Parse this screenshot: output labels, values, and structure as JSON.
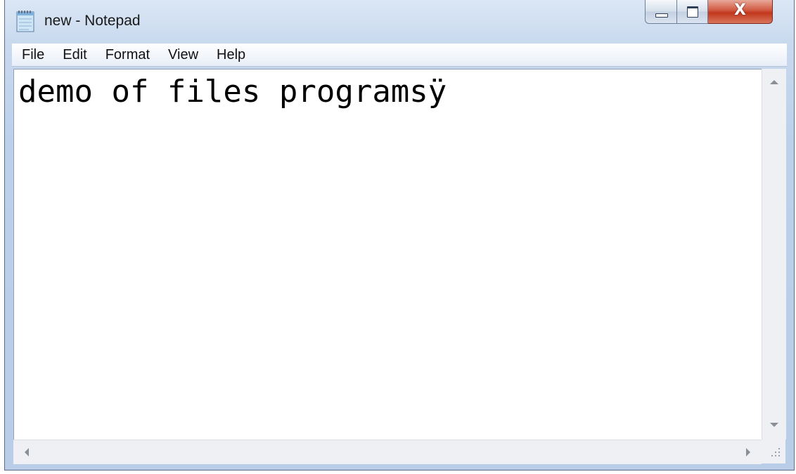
{
  "window": {
    "title": "new - Notepad",
    "close_glyph": "X"
  },
  "icons": {
    "app": "notepad-icon",
    "minimize": "minimize-icon",
    "maximize": "maximize-icon",
    "close": "close-icon"
  },
  "menubar": {
    "items": [
      "File",
      "Edit",
      "Format",
      "View",
      "Help"
    ]
  },
  "editor": {
    "content": "demo of files programsÿ"
  },
  "colors": {
    "close_button": "#c2361c",
    "frame": "#bcd0ea"
  }
}
